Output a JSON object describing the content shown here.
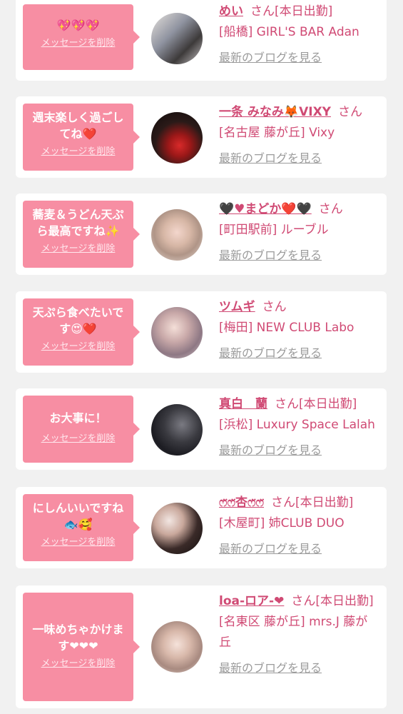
{
  "delete_label": "メッセージを削除",
  "san_label": "さん",
  "blog_label": "最新のブログを見る",
  "colors": {
    "bubble": "#f78ea3",
    "accent": "#d04a74",
    "link_gray": "#9b9b9b",
    "background": "#f1f1f1"
  },
  "messages": [
    {
      "message": "💖💖💖",
      "name": "めい",
      "status": "[本日出勤]",
      "shop": "[船橋] GIRL'S BAR Adan"
    },
    {
      "message": "週末楽しく過ごしてね❤️",
      "name": "一条 みなみ🦊VIXY",
      "status": "",
      "shop": "[名古屋 藤が丘] Vixy"
    },
    {
      "message": "蕎麦＆うどん天ぷら最高ですね✨",
      "name": "🖤♥まどか❤️🖤",
      "status": "",
      "shop": "[町田駅前] ルーブル"
    },
    {
      "message": "天ぷら食べたいです😍❤️",
      "name": "ツムギ",
      "status": "",
      "shop": "[梅田] NEW CLUB Labo"
    },
    {
      "message": "お大事に！",
      "name": "真白　蘭",
      "status": "[本日出勤]",
      "shop": "[浜松] Luxury Space Lalah"
    },
    {
      "message": "にしんいいですね🐟🥰",
      "name": "ෆ̈ෆ̈杏ෆ̈ෆ̈",
      "status": "[本日出勤]",
      "shop": "[木屋町] 姉CLUB DUO"
    },
    {
      "message": "一味めちゃかけます❤❤❤",
      "name": "loa-ロア-❤",
      "status": "[本日出勤]",
      "shop": "[名東区 藤が丘] mrs.J 藤が丘"
    }
  ]
}
